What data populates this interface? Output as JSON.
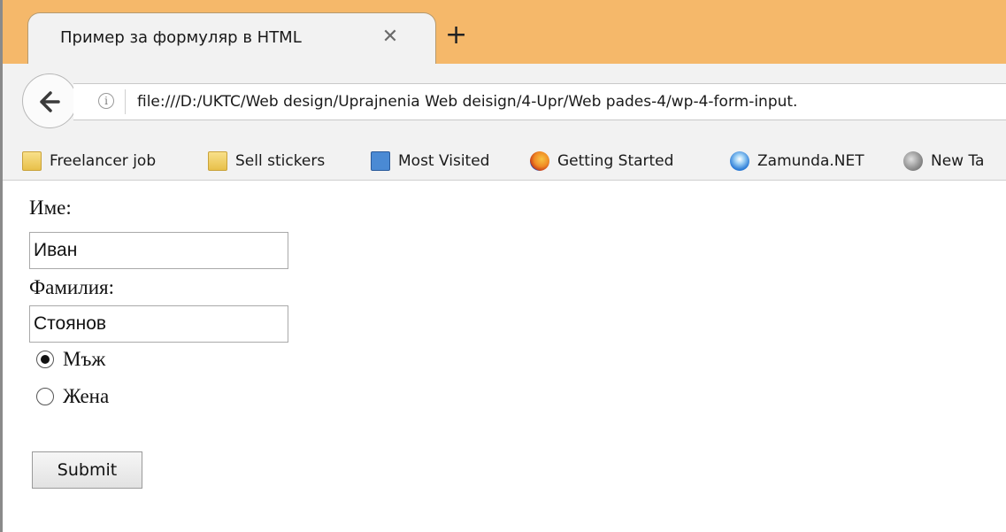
{
  "browser": {
    "tab": {
      "title": "Пример за формуляр в HTML",
      "close_icon": "close-icon"
    },
    "new_tab_icon": "plus-icon",
    "back_icon": "back-arrow-icon",
    "info_icon": "info-icon",
    "url": "file:///D:/UKTC/Web design/Uprajnenia Web deisign/4-Upr/Web pades-4/wp-4-form-input.",
    "bookmarks": [
      {
        "label": "Freelancer job",
        "icon": "folder-icon"
      },
      {
        "label": "Sell stickers",
        "icon": "folder-icon"
      },
      {
        "label": "Most Visited",
        "icon": "most-visited-icon"
      },
      {
        "label": "Getting Started",
        "icon": "firefox-icon"
      },
      {
        "label": "Zamunda.NET",
        "icon": "zamunda-icon"
      },
      {
        "label": "New Ta",
        "icon": "globe-icon"
      }
    ],
    "colors": {
      "tabstrip": "#f5b86a",
      "toolbar": "#f2f2f2"
    }
  },
  "form": {
    "first_name_label": "Име:",
    "first_name_value": "Иван",
    "last_name_label": "Фамилия:",
    "last_name_value": "Стоянов",
    "gender_options": [
      {
        "label": "Мъж",
        "checked": true
      },
      {
        "label": "Жена",
        "checked": false
      }
    ],
    "submit_label": "Submit"
  }
}
